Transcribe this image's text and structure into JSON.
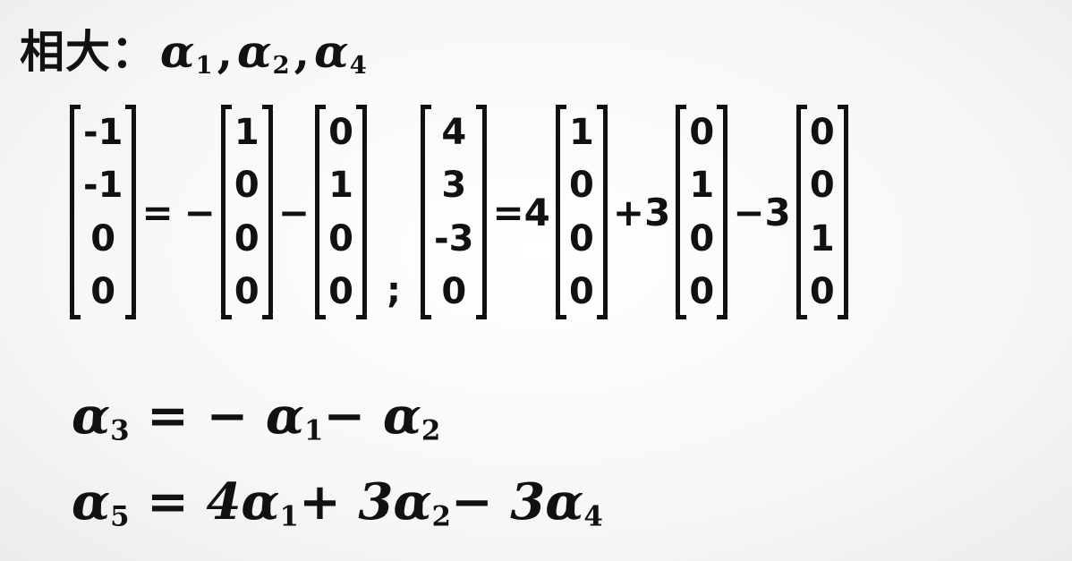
{
  "title": {
    "prefix": "相大：",
    "items": [
      "α",
      "1",
      ", ",
      "α",
      "2",
      ", ",
      "α",
      "4"
    ]
  },
  "vectors": {
    "left_lhs": [
      "-1",
      "-1",
      "0",
      "0"
    ],
    "left_eq": "=",
    "left_op1": "−",
    "left_v1": [
      "1",
      "0",
      "0",
      "0"
    ],
    "left_op2": "−",
    "left_v2": [
      "0",
      "1",
      "0",
      "0"
    ],
    "separator": ";",
    "right_lhs": [
      "4",
      "3",
      "-3",
      "0"
    ],
    "right_eq": "=4",
    "right_v1": [
      "1",
      "0",
      "0",
      "0"
    ],
    "right_op2": "+3",
    "right_v2": [
      "0",
      "1",
      "0",
      "0"
    ],
    "right_op3": "−3",
    "right_v3": [
      "0",
      "0",
      "1",
      "0"
    ]
  },
  "equations": {
    "eq1": {
      "lhs": "α",
      "lhs_sub": "3",
      "rhs": "= − α",
      "rhs_sub1": "1",
      "rhs2": "− α",
      "rhs_sub2": "2"
    },
    "eq2": {
      "lhs": "α",
      "lhs_sub": "5",
      "rhs": "= 4α",
      "rhs_sub1": "1",
      "rhs2": "+ 3α",
      "rhs_sub2": "2",
      "rhs3": "− 3α",
      "rhs_sub3": "4"
    }
  }
}
